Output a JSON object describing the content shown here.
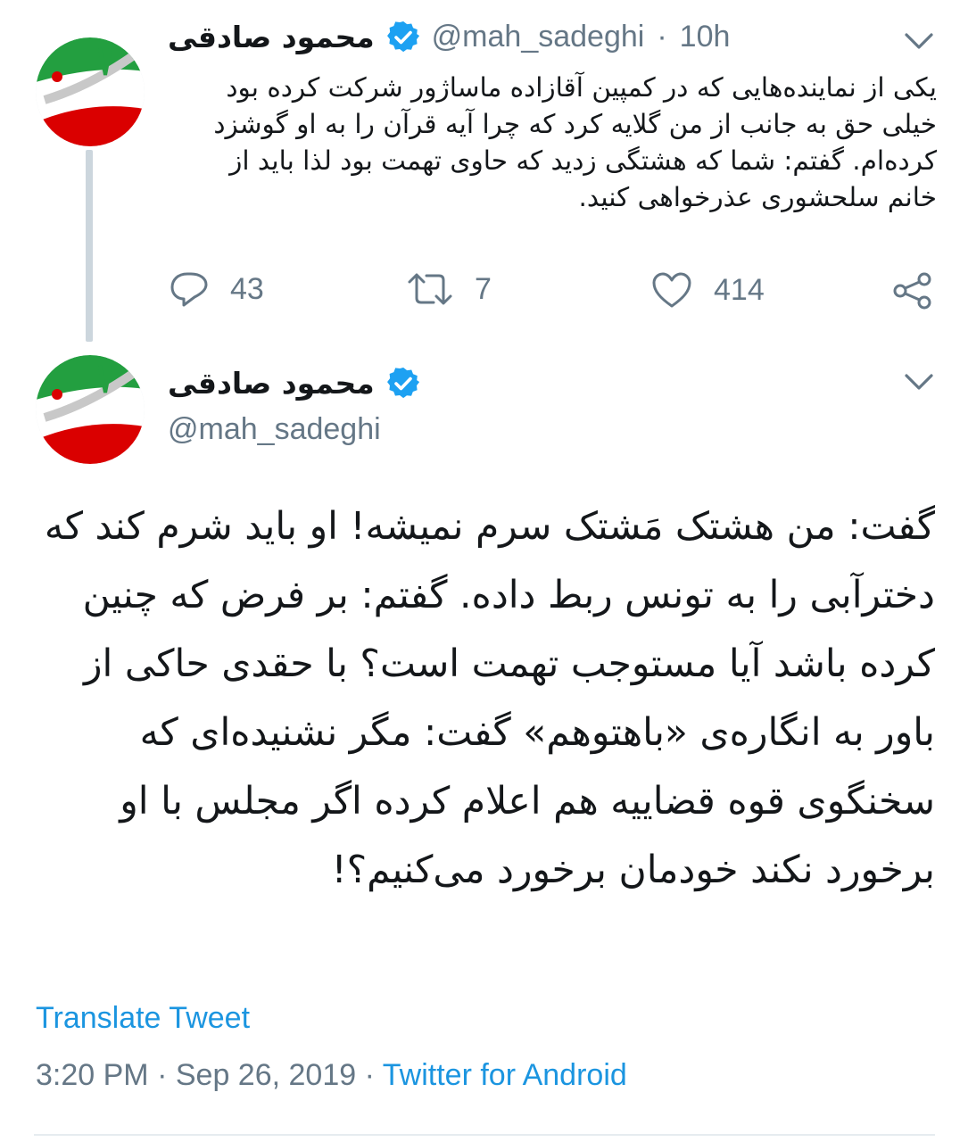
{
  "tweet1": {
    "display_name": "محمود صادقی",
    "handle": "@mah_sadeghi",
    "separator": "·",
    "time_ago": "10h",
    "text": "یکی از نماینده‌هایی که در کمپین آقازاده ماساژور شرکت کرده بود خیلی حق به جانب از من گلایه کرد که چرا آیه قرآن را به او گوشزد کرده‌ام. گفتم: شما که  هشتگی زدید که حاوی تهمت بود لذا باید از خانم سلحشوری عذرخواهی کنید.",
    "replies": "43",
    "retweets": "7",
    "likes": "414"
  },
  "tweet2": {
    "display_name": "محمود صادقی",
    "handle": "@mah_sadeghi",
    "text": "گفت: من هشتک مَشتک سرم نمیشه! او باید شرم کند که دخترآبی را به تونس ربط داده. گفتم: بر فرض که چنین کرده باشد آیا مستوجب تهمت است؟ با حقدی حاکی از باور به انگاره‌ی «باهتوهم» گفت: مگر نشنیده‌ای که سخنگوی قوه قضاییه هم اعلام کرده اگر مجلس با او برخورد نکند خودمان برخورد می‌کنیم؟!",
    "translate_label": "Translate Tweet",
    "time": "3:20 PM",
    "separator": "·",
    "date": "Sep 26, 2019",
    "source": "Twitter for Android"
  },
  "colors": {
    "accent": "#1b95e0",
    "verified": "#1da1f2",
    "muted": "#657786",
    "text": "#14171a"
  },
  "icons": [
    "avatar-flag",
    "verified-badge-icon",
    "chevron-down-icon",
    "reply-icon",
    "retweet-icon",
    "like-icon",
    "share-icon"
  ]
}
